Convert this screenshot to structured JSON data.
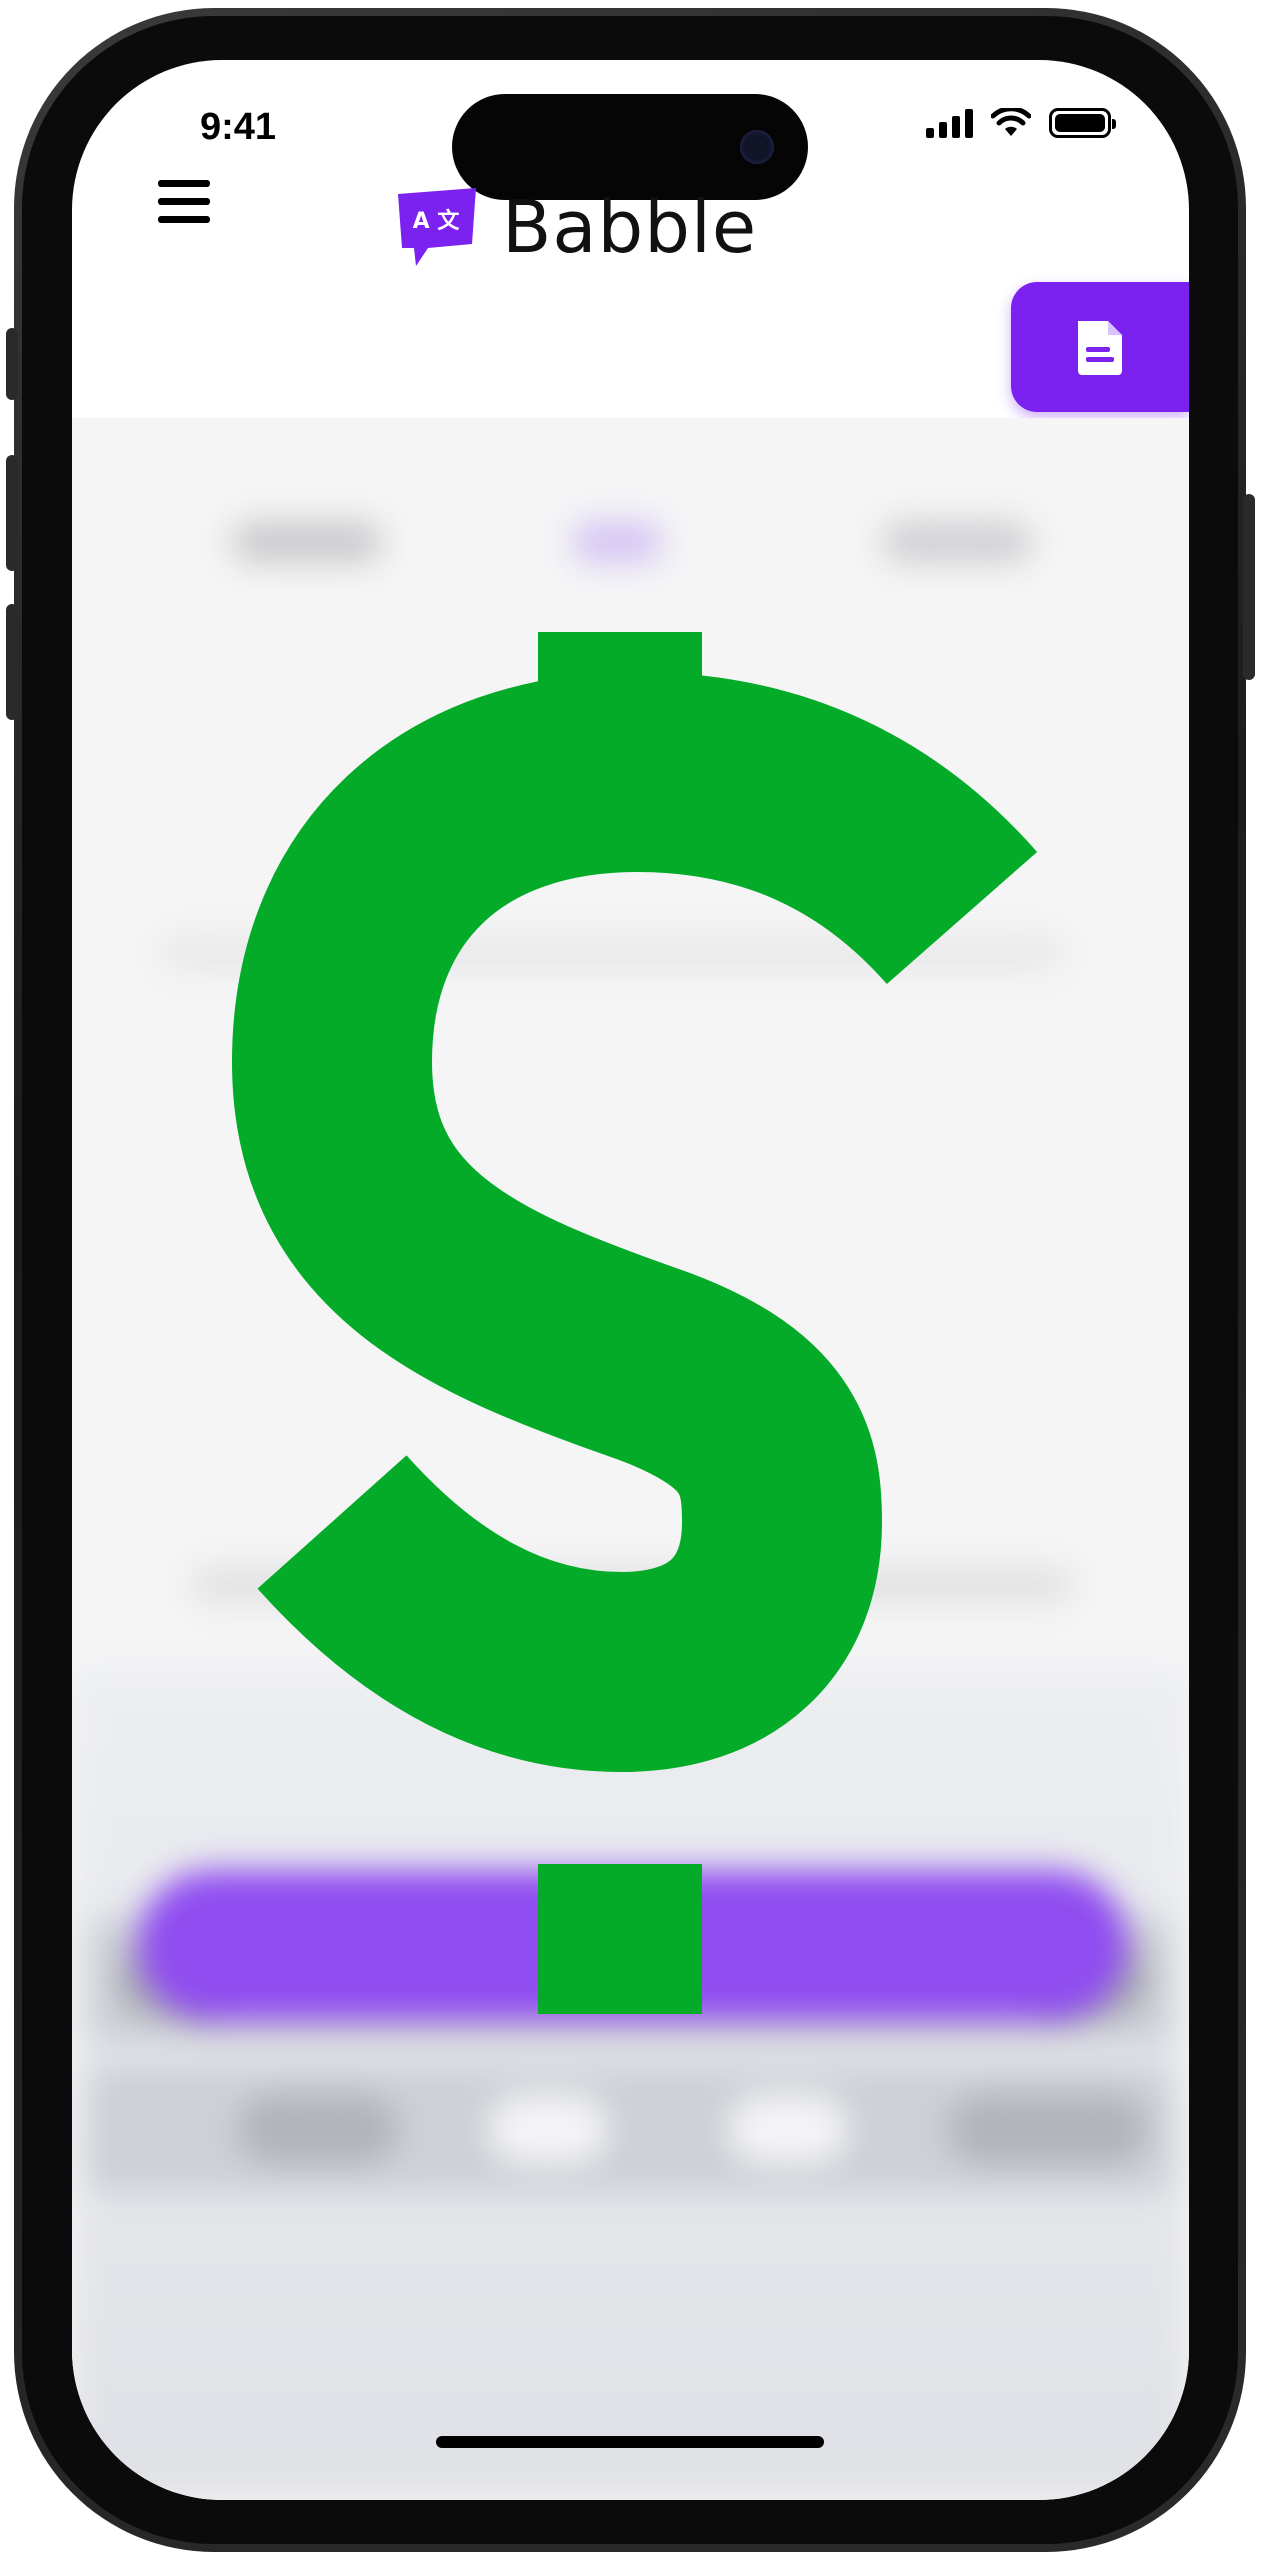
{
  "status_bar": {
    "time": "9:41",
    "icons": [
      "cellular-signal-icon",
      "wifi-icon",
      "battery-icon"
    ]
  },
  "header": {
    "menu_icon": "hamburger-menu-icon",
    "logo_icon": "translate-speech-bubble-icon",
    "logo_glyph": "A 文",
    "app_name": "Babble",
    "action_icon": "document-icon"
  },
  "overlay": {
    "icon": "dollar-sign-icon",
    "color": "#04ab29"
  },
  "colors": {
    "brand_purple": "#7c22f0",
    "overlay_green": "#04ab29",
    "content_bg": "#f5f5f6"
  }
}
